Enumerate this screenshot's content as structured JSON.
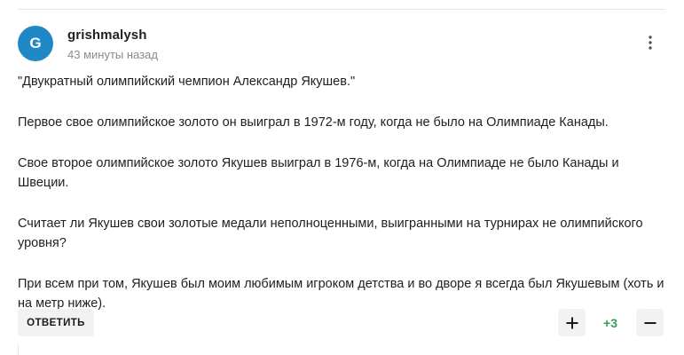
{
  "comment": {
    "author": {
      "initial": "G",
      "username": "grishmalysh",
      "avatar_color": "#1e88c7"
    },
    "timestamp": "43 минуты назад",
    "menu_icon": "more-vertical-icon",
    "paragraphs": [
      "\"Двукратный олимпийский чемпион Александр Якушев.\"",
      "Первое свое олимпийское золото он выиграл в 1972-м году, когда не было на Олимпиаде Канады.",
      "Свое второе олимпийское золото Якушев выиграл в 1976-м, когда на Олимпиаде не было Канады и Швеции.",
      "Считает ли Якушев свои золотые медали неполноценными, выигранными на турнирах не олимпийского уровня?",
      "При всем при том, Якушев был моим любимым игроком детства и во дворе я всегда был Якушевым (хоть и на метр ниже)."
    ],
    "actions": {
      "reply_label": "ОТВЕТИТЬ",
      "upvote_icon": "plus-icon",
      "downvote_icon": "minus-icon",
      "score": "+3",
      "score_color": "#2e9e5b"
    }
  }
}
